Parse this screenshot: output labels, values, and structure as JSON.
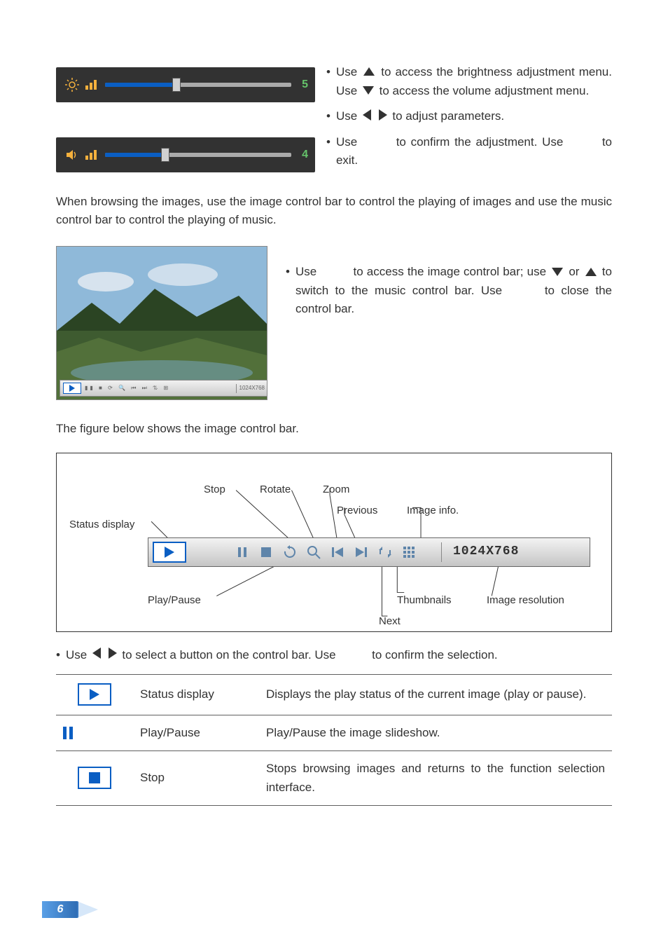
{
  "sliders": {
    "brightness_value": "5",
    "volume_value": "4"
  },
  "bullets": {
    "b1_part1": "Use",
    "b1_part2": "to access the brightness adjustment menu. Use",
    "b1_part3": "to access the volume adjustment menu.",
    "b2_part1": "Use",
    "b2_part2": "to adjust parameters.",
    "b3_part1": "Use",
    "b3_part2": "to confirm the adjustment. Use",
    "b3_part3": "to exit.",
    "b4_part1": "Use",
    "b4_part2": "to access the image control bar; use",
    "b4_part3": "or",
    "b4_part4": "to switch to the music control bar. Use",
    "b4_part5": "to close the control bar.",
    "b5_part1": "Use",
    "b5_part2": "to select a button on the control bar. Use",
    "b5_part3": "to confirm the selection."
  },
  "para_control_bars": "When browsing the images, use the image control bar to control the playing of images and use the music control bar to control the playing of music.",
  "caption_figure": "The figure below shows the image control bar.",
  "viewer_resolution": "1024X768",
  "labels": {
    "status_display": "Status display",
    "play_pause": "Play/Pause",
    "stop": "Stop",
    "rotate": "Rotate",
    "zoom": "Zoom",
    "previous": "Previous",
    "next": "Next",
    "thumbnails": "Thumbnails",
    "image_info": "Image info.",
    "image_resolution": "Image resolution"
  },
  "bigbar_resolution": "1024X768",
  "table": {
    "rows": [
      {
        "name": "Status display",
        "desc": "Displays the play status of the current image (play or pause)."
      },
      {
        "name": "Play/Pause",
        "desc": "Play/Pause the image slideshow."
      },
      {
        "name": "Stop",
        "desc": "Stops browsing images and returns to the function selection interface."
      }
    ]
  },
  "page_number": "6"
}
